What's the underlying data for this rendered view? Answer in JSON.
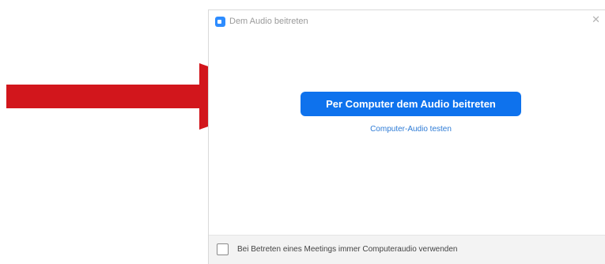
{
  "dialog": {
    "title": "Dem Audio beitreten",
    "primary_button_label": "Per Computer dem Audio beitreten",
    "test_link_label": "Computer-Audio testen",
    "checkbox_label": "Bei Betreten eines Meetings immer Computeraudio verwenden",
    "checkbox_checked": false
  },
  "icons": {
    "app": "zoom-app-icon",
    "close": "close-icon",
    "annotation": "red-arrow-icon"
  },
  "colors": {
    "primary_button": "#0e72ed",
    "link": "#2d7bd6",
    "arrow": "#d2161c",
    "app_icon": "#2d8cff"
  }
}
